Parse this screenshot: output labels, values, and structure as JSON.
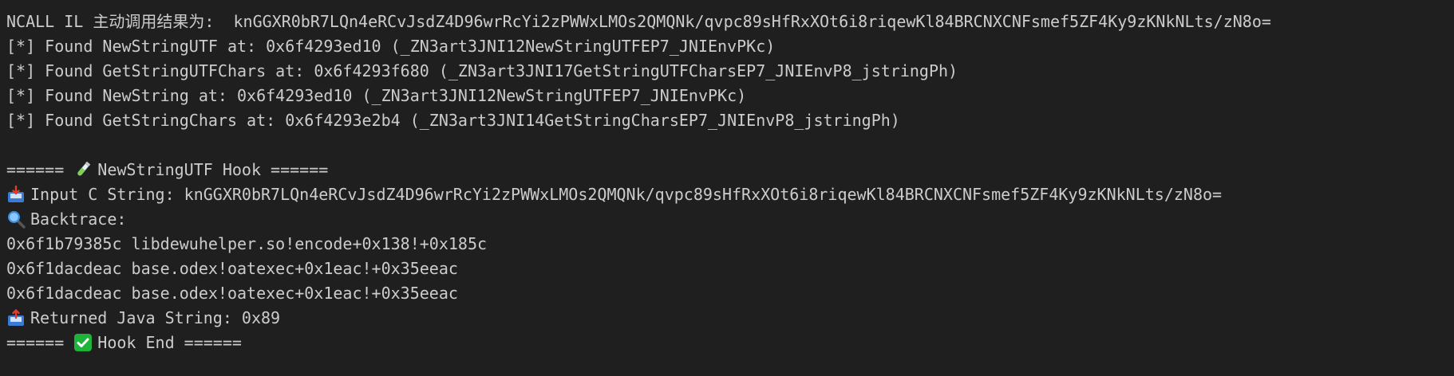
{
  "lines": [
    "NCALL IL 主动调用结果为:  knGGXR0bR7LQn4eRCvJsdZ4D96wrRcYi2zPWWxLMOs2QMQNk/qvpc89sHfRxXOt6i8riqewKl84BRCNXCNFsmef5ZF4Ky9zKNkNLts/zN8o=",
    "[*] Found NewStringUTF at: 0x6f4293ed10 (_ZN3art3JNI12NewStringUTFEP7_JNIEnvPKc)",
    "[*] Found GetStringUTFChars at: 0x6f4293f680 (_ZN3art3JNI17GetStringUTFCharsEP7_JNIEnvP8_jstringPh)",
    "[*] Found NewString at: 0x6f4293ed10 (_ZN3art3JNI12NewStringUTFEP7_JNIEnvPKc)",
    "[*] Found GetStringChars at: 0x6f4293e2b4 (_ZN3art3JNI14GetStringCharsEP7_JNIEnvP8_jstringPh)",
    "",
    "",
    "Input C String: knGGXR0bR7LQn4eRCvJsdZ4D96wrRcYi2zPWWxLMOs2QMQNk/qvpc89sHfRxXOt6i8riqewKl84BRCNXCNFsmef5ZF4Ky9zKNkNLts/zN8o=",
    "Backtrace:",
    "0x6f1b79385c libdewuhelper.so!encode+0x138!+0x185c",
    "0x6f1dacdeac base.odex!oatexec+0x1eac!+0x35eeac",
    "0x6f1dacdeac base.odex!oatexec+0x1eac!+0x35eeac",
    "Returned Java String: 0x89",
    ""
  ],
  "hook_header": {
    "prefix": "====== ",
    "title": "NewStringUTF Hook ======"
  },
  "hook_footer": {
    "prefix": "====== ",
    "title": "Hook End ======"
  },
  "icons": {
    "test_tube": "test-tube-icon",
    "inbox": "inbox-tray-icon",
    "magnifier": "magnifying-glass-icon",
    "outbox": "outbox-tray-icon",
    "check": "check-mark-icon"
  },
  "colors": {
    "background": "#1f1f1f",
    "text": "#cccccc",
    "check_green": "#1fb33b"
  }
}
